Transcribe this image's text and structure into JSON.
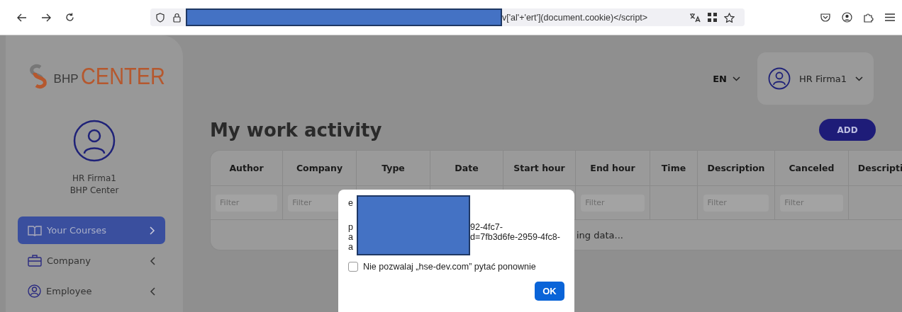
{
  "browser": {
    "url_visible": "v['al'+'ert'](document.cookie)</script>"
  },
  "sidebar": {
    "logo": {
      "prefix": "BHP",
      "main": "CENTER"
    },
    "user": {
      "name": "HR Firma1",
      "org": "BHP Center"
    },
    "items": [
      {
        "label": "Your Courses",
        "selected": true
      },
      {
        "label": "Company",
        "selected": false
      },
      {
        "label": "Employee",
        "selected": false
      }
    ]
  },
  "header": {
    "language": "EN",
    "user": "HR Firma1"
  },
  "page": {
    "title": "My work activity",
    "add_button": "ADD"
  },
  "table": {
    "columns": [
      {
        "label": "Author",
        "placeholder": "Filter"
      },
      {
        "label": "Company",
        "placeholder": "Filter"
      },
      {
        "label": "Type"
      },
      {
        "label": "Date"
      },
      {
        "label": "Start hour"
      },
      {
        "label": "End hour",
        "placeholder": "Filter"
      },
      {
        "label": "Time"
      },
      {
        "label": "Description",
        "placeholder": "Filter"
      },
      {
        "label": "Canceled",
        "placeholder": "Filter"
      },
      {
        "label": "Descripti"
      }
    ],
    "loading": "ing data..."
  },
  "dialog": {
    "top_fragment": "e",
    "lines": [
      {
        "left": "p",
        "right": "92-4fc7-"
      },
      {
        "left": "a",
        "right": "d=7fb3d6fe-2959-4fc8-"
      },
      {
        "left": "a"
      }
    ],
    "checkbox": {
      "label": "Nie pozwalaj „hse-dev.com” pytać ponownie",
      "checked": false
    },
    "ok": "OK"
  }
}
